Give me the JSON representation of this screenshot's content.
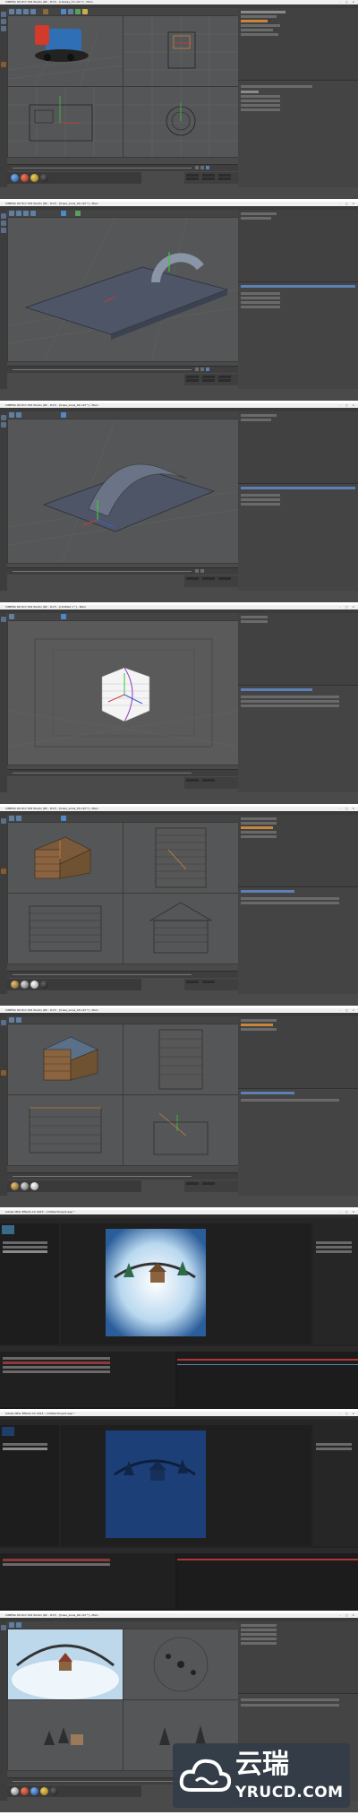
{
  "frames": [
    {
      "title": "CINEMA 4D R17.032 Studio (RC - R17) - [railway_T1.c4d *] - Main",
      "window_controls": "– □ ×"
    },
    {
      "title": "CINEMA 4D R17.032 Studio (RC - R17) - [trees_snow_02.c4d *] - Main",
      "window_controls": "– □ ×"
    },
    {
      "title": "CINEMA 4D R17.032 Studio (RC - R17) - [trees_snow_02.c4d *] - Main",
      "window_controls": "– □ ×"
    },
    {
      "title": "CINEMA 4D R17.032 Studio (RC - R17) - [Untitled 1 *] - Main",
      "window_controls": "– □ ×"
    },
    {
      "title": "CINEMA 4D R17.032 Studio (RC - R17) - [trees_snow_03.c4d *] - Main",
      "window_controls": "– □ ×"
    },
    {
      "title": "CINEMA 4D R17.032 Studio (RC - R17) - [trees_snow_03.c4d *] - Main",
      "window_controls": "– □ ×"
    },
    {
      "title": "Adobe After Effects CC 2015 - Untitled Project.aep *",
      "window_controls": "– □ ×"
    },
    {
      "title": "Adobe After Effects CC 2015 - Untitled Project.aep *",
      "window_controls": "– □ ×"
    },
    {
      "title": "CINEMA 4D R17.032 Studio (RC - R17) - [trees_snow_04.c4d *] - Main",
      "window_controls": "– □ ×"
    }
  ],
  "watermark": {
    "cn": "云瑞",
    "en": "YRUCD.COM"
  },
  "colors": {
    "c4d_bg": "#4a4a4a",
    "viewport": "#555657",
    "ae_bg": "#232323",
    "selection_orange": "#c9863b",
    "axis_red": "#d23a3a",
    "axis_green": "#3ec43e",
    "axis_blue": "#3a5ed2"
  }
}
